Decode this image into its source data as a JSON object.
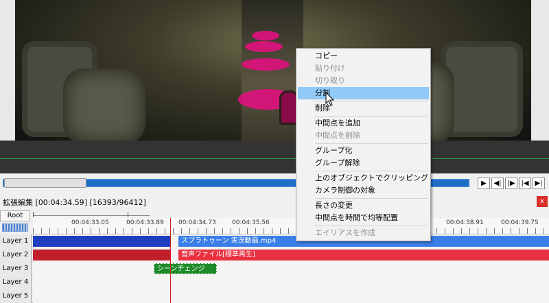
{
  "extended_edit": {
    "title": "拡張編集 [00:04:34.59] [16393/96412]",
    "close_label": "x"
  },
  "timeline": {
    "root_label": "Root",
    "ruler_labels": [
      "00:04:33.05",
      "00:04:33.89",
      "00:04:34.73",
      "00:04:35.56",
      "00:04:38.91",
      "00:04:39.75"
    ],
    "layers": [
      "Layer 1",
      "Layer 2",
      "Layer 3",
      "Layer 4",
      "Layer 5"
    ],
    "clips": {
      "layer1_right": "スプラトゥーン 実況動画.mp4",
      "layer2_right": "音声ファイル[標準再生]",
      "layer3": "シーンチェンジ"
    }
  },
  "playback_controls": {
    "play": "▶",
    "prev_frame": "◀|",
    "next_frame": "|▶",
    "to_start": "|◀",
    "to_end": "▶|"
  },
  "context_menu": {
    "items": [
      {
        "label": "コピー",
        "enabled": true
      },
      {
        "label": "貼り付け",
        "enabled": false
      },
      {
        "label": "切り取り",
        "enabled": false
      },
      {
        "label": "分割",
        "enabled": true,
        "highlighted": true
      },
      {
        "label": "削除",
        "enabled": true
      },
      {
        "label": "中間点を追加",
        "enabled": true
      },
      {
        "label": "中間点を削除",
        "enabled": false
      },
      {
        "label": "グループ化",
        "enabled": true
      },
      {
        "label": "グループ解除",
        "enabled": true
      },
      {
        "label": "上のオブジェクトでクリッピング",
        "enabled": true
      },
      {
        "label": "カメラ制御の対象",
        "enabled": true
      },
      {
        "label": "長さの変更",
        "enabled": true
      },
      {
        "label": "中間点を時間で均等配置",
        "enabled": true
      },
      {
        "label": "エイリアスを作成",
        "enabled": false
      }
    ]
  },
  "colors": {
    "layer1_clip": "#1f3fc0",
    "layer1_clip_right": "#3a7fe8",
    "layer2_clip": "#c0202a",
    "layer2_clip_right": "#e83040",
    "layer3_clip": "#1f8a2a",
    "menu_highlight": "#91c9f7",
    "playhead": "#d02020"
  },
  "icons": [
    "mouse-cursor-icon",
    "close-icon",
    "play-icon",
    "prev-frame-icon",
    "next-frame-icon",
    "to-start-icon",
    "to-end-icon"
  ]
}
